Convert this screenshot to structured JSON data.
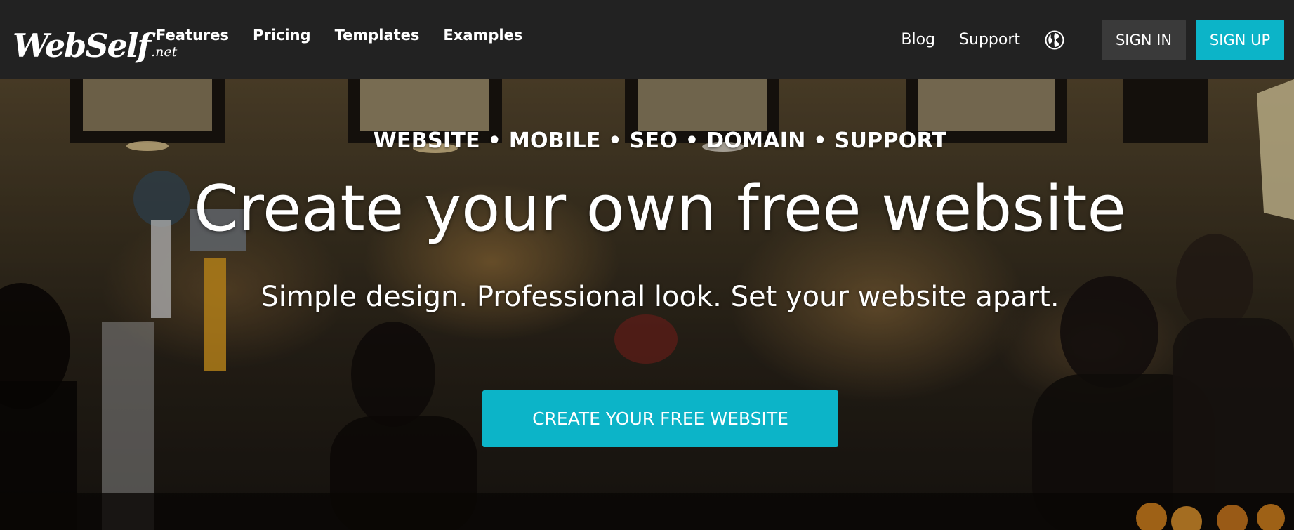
{
  "brand": {
    "logo_text": "WebSelf",
    "logo_tld": ".net"
  },
  "nav": {
    "left_links": [
      "Features",
      "Pricing",
      "Templates",
      "Examples"
    ],
    "blog": "Blog",
    "support": "Support",
    "globe_icon": "globe-icon",
    "sign_in": "SIGN IN",
    "sign_up": "SIGN UP"
  },
  "hero": {
    "tagline": "WEBSITE • MOBILE • SEO • DOMAIN • SUPPORT",
    "title": "Create your own free website",
    "subtitle": "Simple design. Professional look. Set your website apart.",
    "cta": "CREATE YOUR FREE WEBSITE"
  },
  "colors": {
    "nav_background": "#222222",
    "accent": "#0cb4c8",
    "sign_in_background": "#3a3a3a",
    "text": "#ffffff"
  }
}
